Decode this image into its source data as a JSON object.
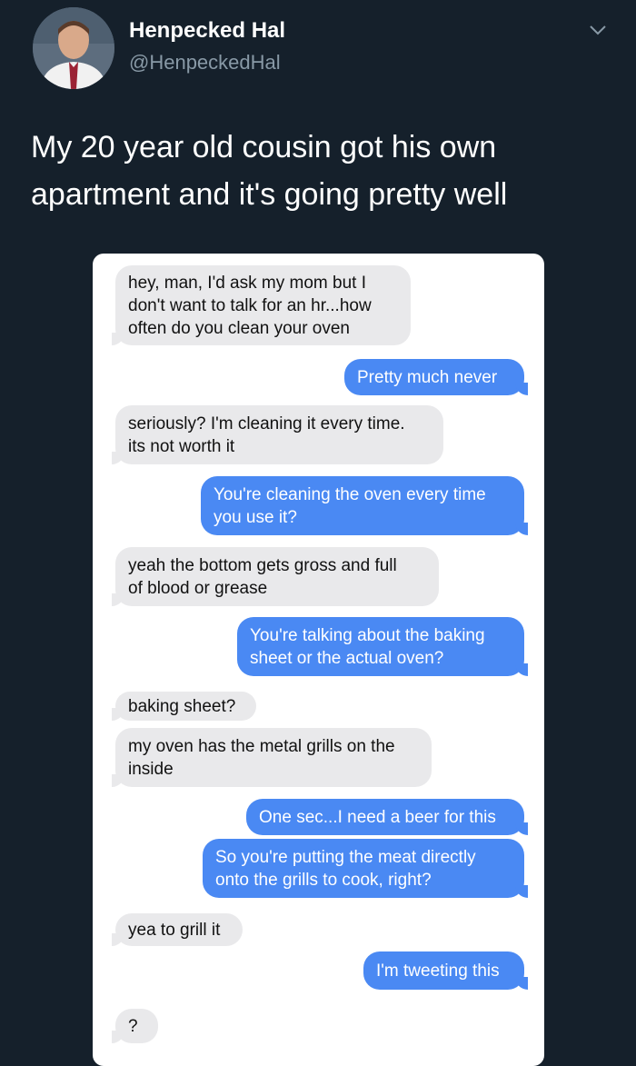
{
  "tweet": {
    "display_name": "Henpecked Hal",
    "handle": "@HenpeckedHal",
    "text": "My 20 year old cousin got his own apartment and it's going pretty well"
  },
  "icons": {
    "avatar": "profile-photo",
    "menu": "chevron-down-icon"
  },
  "colors": {
    "background": "#15202b",
    "incoming": "#e9e9eb",
    "outgoing": "#4a89f3"
  },
  "messages": [
    {
      "side": "in",
      "text": "hey, man, I'd ask my mom but I\ndon't want to talk for an hr...how\noften do you clean your oven"
    },
    {
      "side": "out",
      "text": "Pretty much never"
    },
    {
      "side": "in",
      "text": "seriously? I'm cleaning it every time.\nits not worth it"
    },
    {
      "side": "out",
      "text": "You're cleaning the oven every time\nyou use it?"
    },
    {
      "side": "in",
      "text": "yeah the bottom gets gross and full\nof blood or grease"
    },
    {
      "side": "out",
      "text": "You're talking about the baking\nsheet or the actual oven?"
    },
    {
      "side": "in",
      "text": "baking sheet?"
    },
    {
      "side": "in",
      "text": "my oven has the metal grills on the\ninside"
    },
    {
      "side": "out",
      "text": "One sec...I need a beer for this"
    },
    {
      "side": "out",
      "text": "So you're putting the meat directly\nonto the grills to cook, right?"
    },
    {
      "side": "in",
      "text": "yea to grill it"
    },
    {
      "side": "out",
      "text": "I'm tweeting this"
    },
    {
      "side": "in",
      "text": "?"
    }
  ]
}
